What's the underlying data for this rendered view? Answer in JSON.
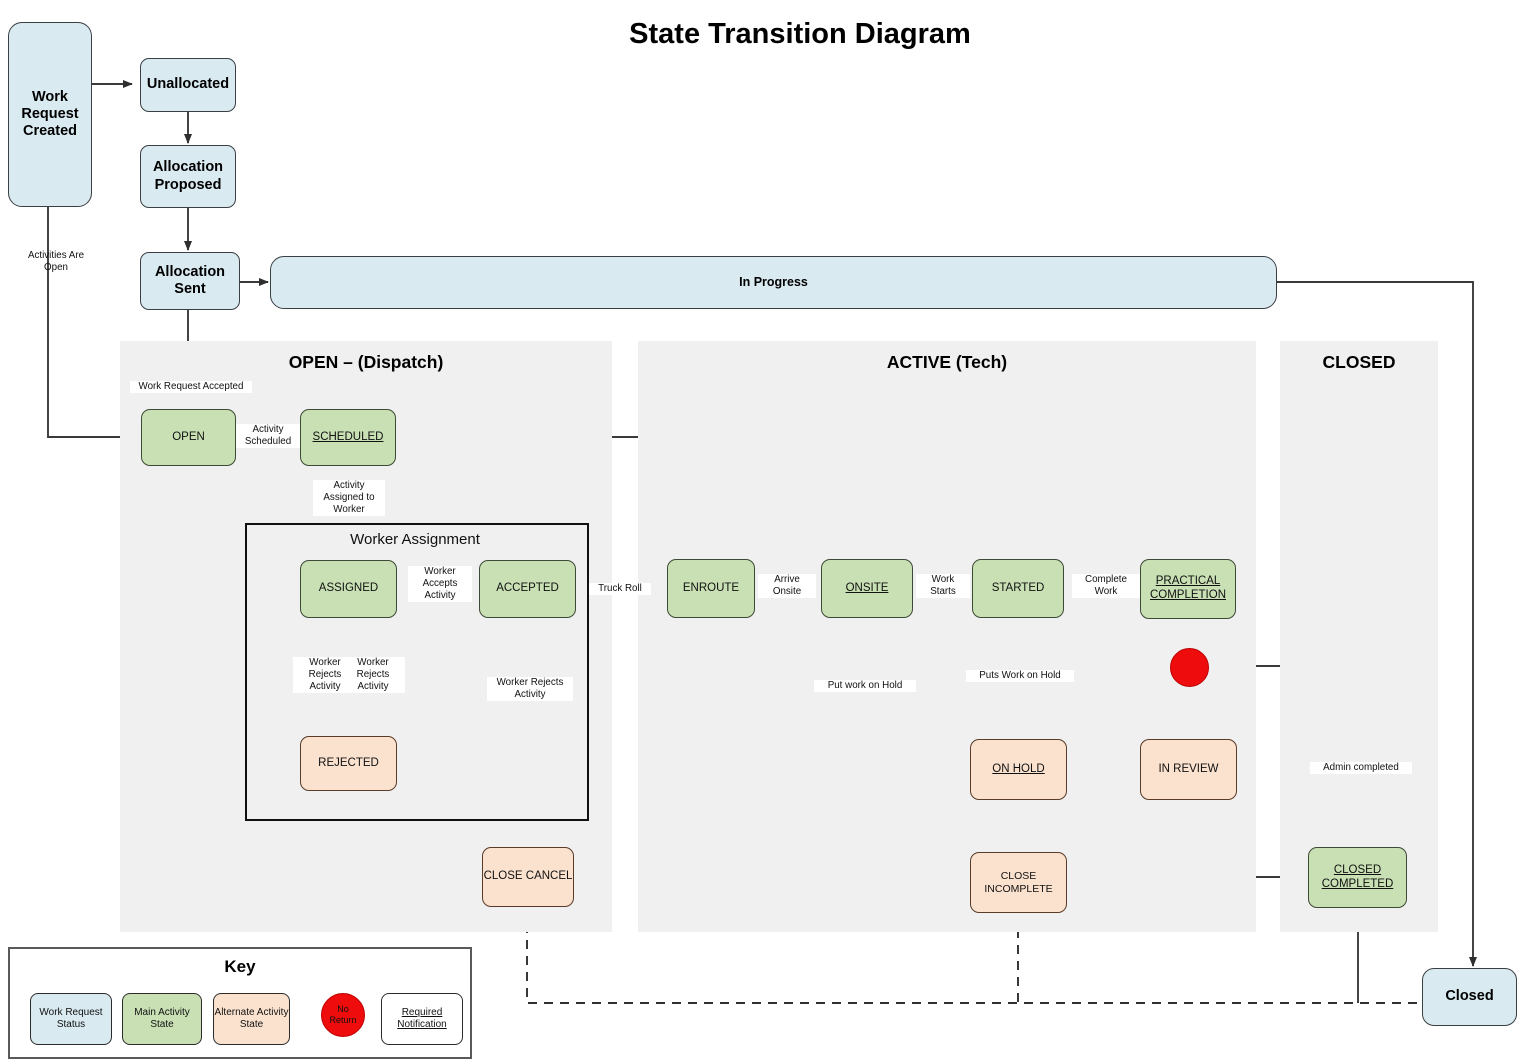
{
  "title": "State Transition Diagram",
  "colors": {
    "work_request_status": "#d9eaf1",
    "main_activity_state": "#c8e0b4",
    "alternate_activity_state": "#fbe2cf",
    "no_return": "#ee0c0c",
    "required_notification": "#ffffff",
    "lane_background": "#f0f0f0"
  },
  "work_request_states": {
    "created": "Work\nRequest\nCreated",
    "created_lines": [
      "Work",
      "Request",
      "Created"
    ],
    "unallocated": "Unallocated",
    "allocation_proposed_lines": [
      "Allocation",
      "Proposed"
    ],
    "allocation_sent_lines": [
      "Allocation",
      "Sent"
    ],
    "in_progress": "In Progress",
    "closed": "Closed"
  },
  "lanes": [
    {
      "id": "open",
      "title": "OPEN – (Dispatch)"
    },
    {
      "id": "active",
      "title": "ACTIVE (Tech)"
    },
    {
      "id": "closed",
      "title": "CLOSED"
    }
  ],
  "groups": [
    {
      "id": "worker-assignment",
      "title": "Worker Assignment"
    }
  ],
  "activity_states": {
    "open": "OPEN",
    "scheduled": "SCHEDULED",
    "assigned": "ASSIGNED",
    "accepted": "ACCEPTED",
    "rejected": "REJECTED",
    "close_cancel": "CLOSE CANCEL",
    "enroute": "ENROUTE",
    "onsite": "ONSITE",
    "started": "STARTED",
    "practical_completion_lines": [
      "PRACTICAL",
      "COMPLETION"
    ],
    "on_hold": "ON HOLD",
    "in_review": "IN REVIEW",
    "close_incomplete": "CLOSE INCOMPLETE",
    "closed_completed_lines": [
      "CLOSED",
      "COMPLETED"
    ]
  },
  "edge_labels": {
    "activities_are_open_lines": [
      "Activities Are",
      "Open"
    ],
    "work_request_accepted": "Work Request Accepted",
    "activity_scheduled_lines": [
      "Activity",
      "Scheduled"
    ],
    "activity_assigned_to_worker_lines": [
      "Activity",
      "Assigned to",
      "Worker"
    ],
    "worker_accepts_activity_lines": [
      "Worker",
      "Accepts",
      "Activity"
    ],
    "worker_rejects_activity_a_lines": [
      "Worker",
      "Rejects",
      "Activity"
    ],
    "worker_rejects_activity_b_lines": [
      "Worker",
      "Rejects",
      "Activity"
    ],
    "worker_rejects_activity_c_lines": [
      "Worker Rejects",
      "Activity"
    ],
    "truck_roll": "Truck Roll",
    "arrive_onsite_lines": [
      "Arrive",
      "Onsite"
    ],
    "work_starts_lines": [
      "Work",
      "Starts"
    ],
    "complete_work_lines": [
      "Complete",
      "Work"
    ],
    "put_work_on_hold": "Put work on Hold",
    "puts_work_on_hold": "Puts Work on Hold",
    "admin_completed": "Admin completed"
  },
  "key": {
    "title": "Key",
    "items": [
      {
        "label_lines": [
          "Work Request",
          "Status"
        ],
        "style": "blue"
      },
      {
        "label_lines": [
          "Main Activity",
          "State"
        ],
        "style": "green"
      },
      {
        "label_lines": [
          "Alternate Activity",
          "State"
        ],
        "style": "orange"
      },
      {
        "label_lines": [
          "No",
          "Return"
        ],
        "style": "red-circle"
      },
      {
        "label_lines": [
          "Required",
          "Notification"
        ],
        "style": "white-underline"
      }
    ]
  }
}
